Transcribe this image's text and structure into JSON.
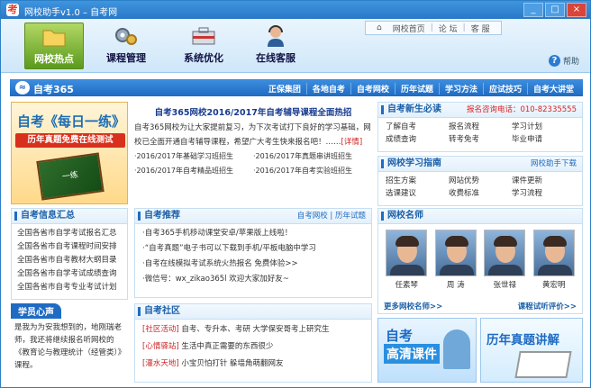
{
  "window": {
    "title": "网校助手v1.0 – 自考网",
    "min": "_",
    "max": "□",
    "close": "×"
  },
  "toplinks": {
    "home": "网校首页",
    "forum": "论 坛",
    "service": "客 服"
  },
  "help": {
    "label": "帮助"
  },
  "nav": [
    {
      "label": "网校热点"
    },
    {
      "label": "课程管理"
    },
    {
      "label": "系统优化"
    },
    {
      "label": "在线客服"
    }
  ],
  "brand": {
    "name": "自考365",
    "links": [
      "正保集团",
      "各地自考",
      "自考网校",
      "历年试题",
      "学习方法",
      "应试技巧",
      "自考大讲堂"
    ]
  },
  "banner": {
    "line1": "自考《每日一练》",
    "line2": "历年真题免费在线测试",
    "book": "一练"
  },
  "headline": {
    "title": "自考365网校2016/2017年自考辅导课程全面热招",
    "body": "自考365网校为让大家提前复习，为下次考试打下良好的学习基础，网校已全面开通自考辅导课程，希望广大考生快来报名吧！……",
    "more": "[详情]",
    "items": [
      "·2016/2017年基础学习班招生",
      "·2016/2017年真题串讲班招生",
      "·2016/2017年自考精品班招生",
      "·2016/2017年自考实验班招生"
    ]
  },
  "freshman": {
    "title": "自考新生必读",
    "phone": "报名咨询电话：010-82335555",
    "links": [
      "了解自考",
      "报名流程",
      "学习计划",
      "成绩查询",
      "转考免考",
      "毕业申请"
    ]
  },
  "guide": {
    "title": "网校学习指南",
    "download": "网校助手下载",
    "links": [
      "招生方案",
      "网站优势",
      "课件更新",
      "选课建议",
      "收费标准",
      "学习流程"
    ]
  },
  "info": {
    "title": "自考信息汇总",
    "items": [
      "全国各省市自学考试报名汇总",
      "全国各省市自考课程时间安排",
      "全国各省市自考教材大纲目录",
      "全国各省市自学考试成绩查询",
      "全国各省市自考专业考试计划"
    ]
  },
  "recommend": {
    "title": "自考推荐",
    "right1": "自考网校",
    "right2": "历年试题",
    "items": [
      "·自考365手机移动课堂安卓/苹果版上线啦！",
      "·“自考真题”电子书可以下载到手机/平板电脑中学习",
      "·自考在线模拟考试系统火热报名 免费体验>>",
      "·微信号：wx_zikao365l 欢迎大家加好友~"
    ]
  },
  "community": {
    "title": "自考社区",
    "items": [
      {
        "tag": "[社区活动]",
        "text": "自考、专升本、考研 大学保安哥考上研究生"
      },
      {
        "tag": "[心情驿站]",
        "text": "生活中真正需要的东西很少"
      },
      {
        "tag": "[灌水天地]",
        "text": "小宝贝怕打针 躲墙角萌翻网友"
      }
    ]
  },
  "teachers": {
    "title": "网校名师",
    "list": [
      {
        "name": "任素琴"
      },
      {
        "name": "周 涛"
      },
      {
        "name": "张世禄"
      },
      {
        "name": "黄宏明"
      }
    ],
    "more": "更多网校名师>>",
    "trial": "课程试听评价>>"
  },
  "voice": {
    "title": "学员心声",
    "text": "是我为为安我想到的，地刚瑞老师，我还将继续报名听网校的《教育论与教理统计（经管类）》课程。"
  },
  "ads": {
    "ad1_line1": "自考",
    "ad1_line2": "高清课件",
    "ad2": "历年真题讲解"
  }
}
